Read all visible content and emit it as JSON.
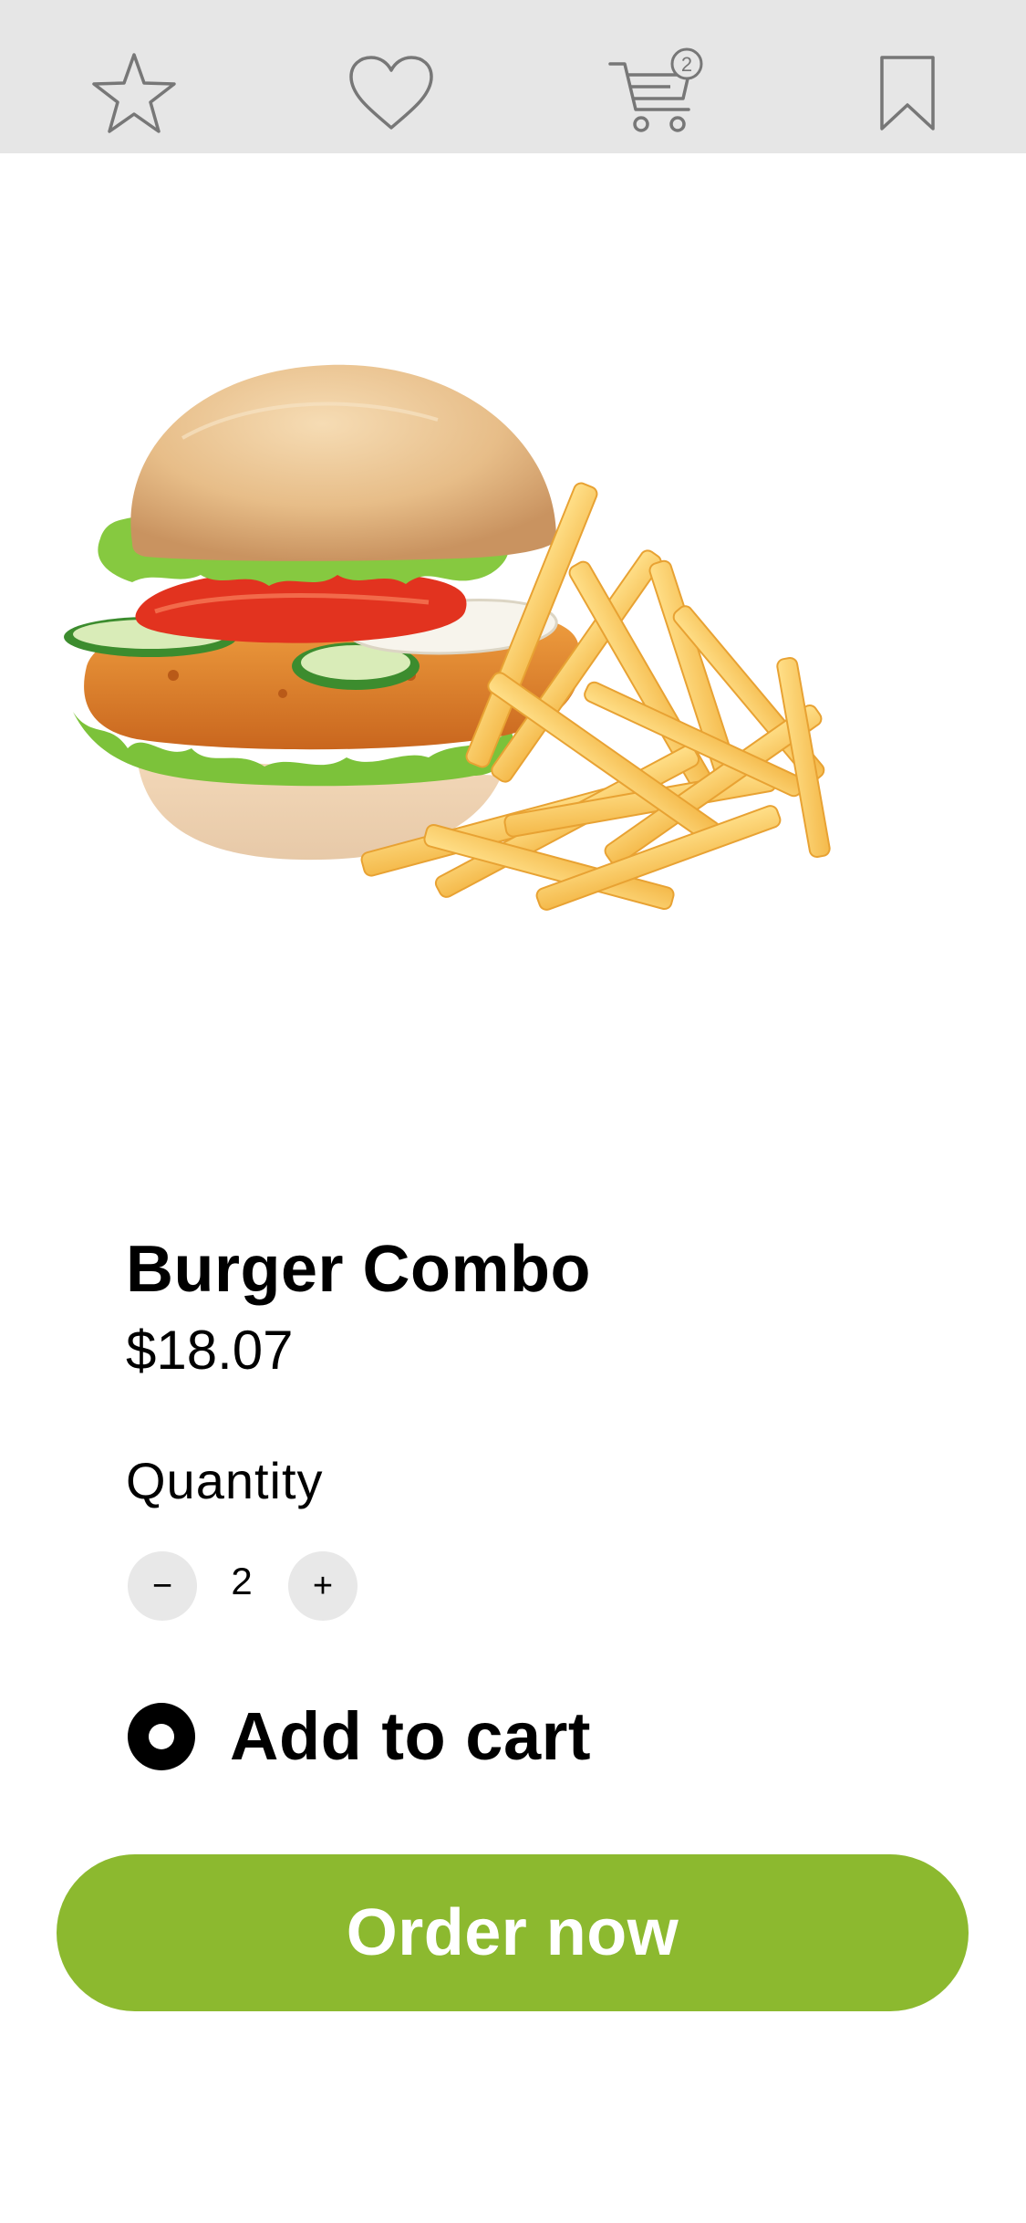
{
  "colors": {
    "topbar_bg": "#e6e6e6",
    "icon_stroke": "#777777",
    "accent_green": "#8cb92f",
    "stepper_bg": "#e8e8e8"
  },
  "topbar": {
    "icons": [
      "star-icon",
      "heart-icon",
      "cart-icon",
      "bookmark-icon"
    ],
    "cart_count": "2"
  },
  "product": {
    "title": "Burger Combo",
    "price": "$18.07",
    "image": "burger-and-fries-image"
  },
  "quantity": {
    "label": "Quantity",
    "decrement_label": "−",
    "value": "2",
    "increment_label": "+"
  },
  "add_to_cart": {
    "label": "Add to cart",
    "selected": true
  },
  "order_button": {
    "label": "Order now"
  }
}
